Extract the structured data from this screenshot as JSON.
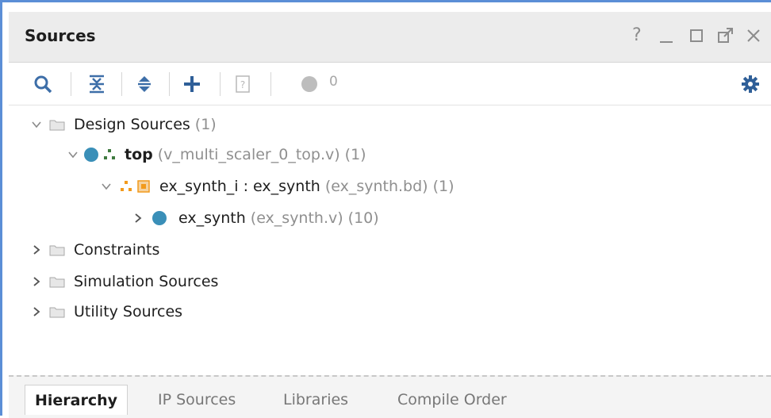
{
  "panel": {
    "title": "Sources",
    "help_label": "?",
    "minimize_icon": "minimize-icon",
    "maximize_icon": "maximize-icon",
    "float_icon": "float-icon",
    "close_icon": "close-icon"
  },
  "toolbar": {
    "buttons": [
      "search-icon",
      "collapse-all-icon",
      "expand-all-icon",
      "add-sources-icon",
      "ip-info-icon",
      "status-dot-icon",
      "gear-icon"
    ],
    "status_count": "0"
  },
  "tree": {
    "items": [
      {
        "label": "Design Sources",
        "count": "(1)",
        "expanded": true
      },
      {
        "label": "top",
        "file": "(v_multi_scaler_0_top.v)",
        "count": "(1)",
        "expanded": true
      },
      {
        "label": "ex_synth_i : ex_synth",
        "file": "(ex_synth.bd)",
        "count": "(1)",
        "expanded": true
      },
      {
        "label": "ex_synth",
        "file": "(ex_synth.v)",
        "count": "(10)",
        "expanded": false
      },
      {
        "label": "Constraints",
        "expanded": false
      },
      {
        "label": "Simulation Sources",
        "expanded": false
      },
      {
        "label": "Utility Sources",
        "expanded": false
      }
    ]
  },
  "tabs": [
    {
      "label": "Hierarchy",
      "active": true
    },
    {
      "label": "IP Sources",
      "active": false
    },
    {
      "label": "Libraries",
      "active": false
    },
    {
      "label": "Compile Order",
      "active": false
    }
  ],
  "colors": {
    "accent": "#5b8ed6",
    "module_dot": "#3a8fb8",
    "bd_orange": "#f29a1c"
  }
}
